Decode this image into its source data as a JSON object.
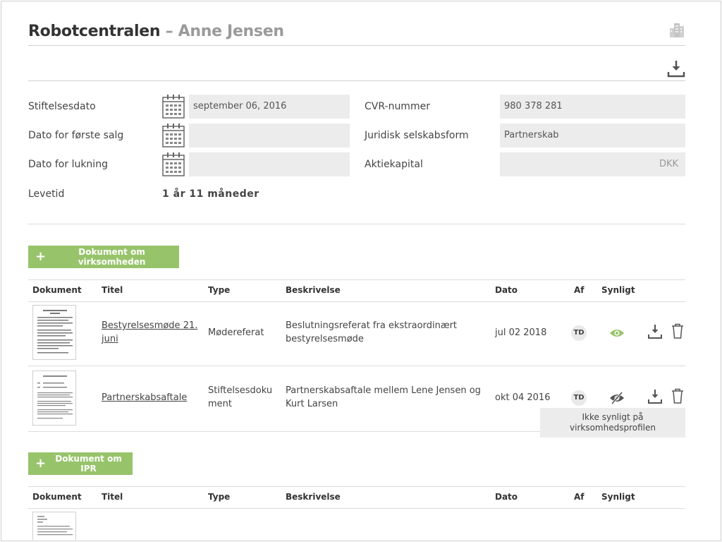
{
  "header": {
    "company": "Robotcentralen",
    "dash": "–",
    "person": "Anne Jensen",
    "icon": "building-icon"
  },
  "toolbar": {
    "download_icon": "download-icon"
  },
  "form": {
    "stiftelsesdato": {
      "label": "Stiftelsesdato",
      "value": "september 06, 2016"
    },
    "forste_salg": {
      "label": "Dato for første salg",
      "value": ""
    },
    "lukning": {
      "label": "Dato for lukning",
      "value": ""
    },
    "levetid": {
      "label": "Levetid",
      "value": "1 år 11 måneder"
    },
    "cvr": {
      "label": "CVR-nummer",
      "value": "980 378 281"
    },
    "selskabsform": {
      "label": "Juridisk selskabsform",
      "value": "Partnerskab"
    },
    "aktiekapital": {
      "label": "Aktiekapital",
      "value": "",
      "currency": "DKK"
    }
  },
  "section1": {
    "button_label": "Dokument om virksomheden",
    "columns": [
      "Dokument",
      "Titel",
      "Type",
      "Beskrivelse",
      "Dato",
      "Af",
      "Synligt"
    ],
    "rows": [
      {
        "title": "Bestyrelsesmøde 21. juni",
        "type": "Mødereferat",
        "description": "Beslutningsreferat fra ekstraordinært bestyrelsesmøde",
        "date": "jul 02 2018",
        "author": "TD",
        "visible": true
      },
      {
        "title": "Partnerskabsaftale",
        "type": "Stiftelsesdokument",
        "description": "Partnerskabsaftale mellem Lene Jensen og Kurt Larsen",
        "date": "okt 04 2016",
        "author": "TD",
        "visible": false
      }
    ],
    "tooltip": "Ikke synligt på virksomhedsprofilen"
  },
  "section2": {
    "button_label": "Dokument om IPR",
    "columns": [
      "Dokument",
      "Titel",
      "Type",
      "Beskrivelse",
      "Dato",
      "Af",
      "Synligt"
    ]
  },
  "colors": {
    "accent_green": "#97c46b",
    "field_bg": "#ececec",
    "visible_eye": "#97c46b",
    "hidden_eye": "#555555"
  }
}
